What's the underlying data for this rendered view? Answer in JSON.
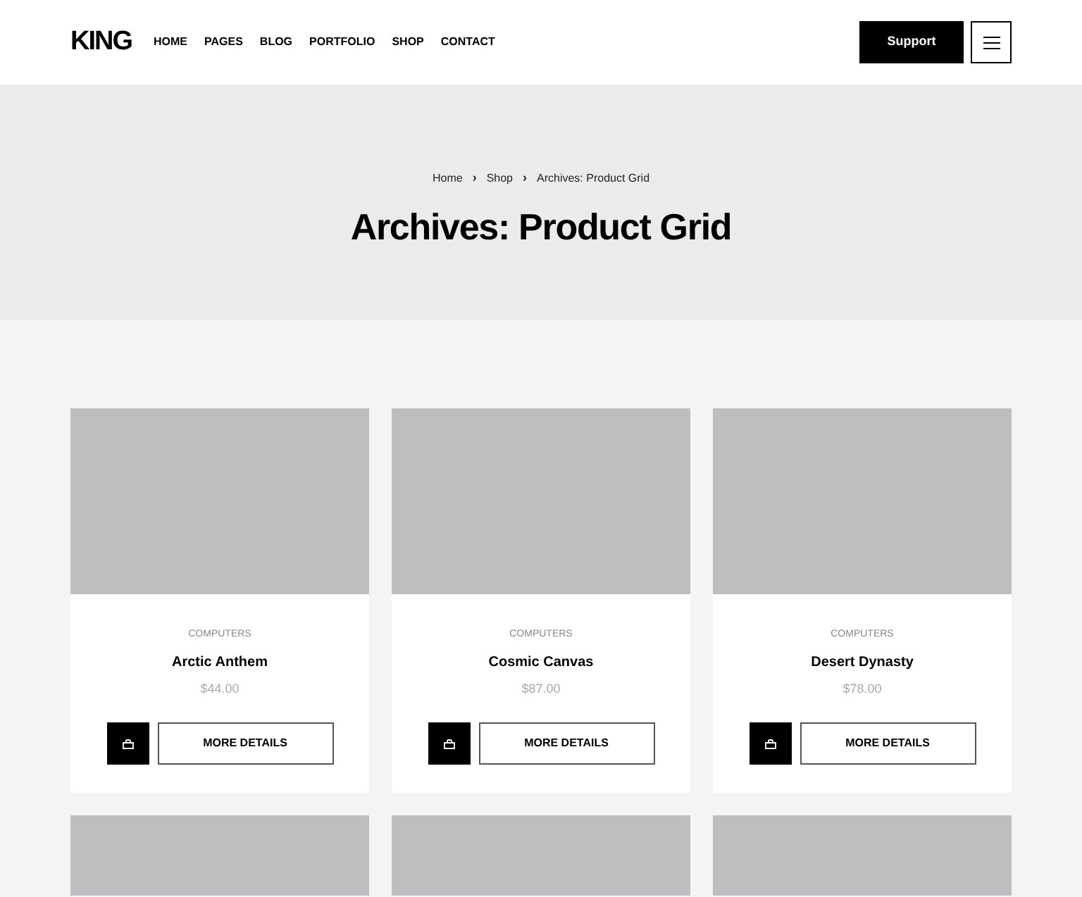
{
  "header": {
    "logo": "KING",
    "nav": [
      {
        "label": "HOME"
      },
      {
        "label": "PAGES"
      },
      {
        "label": "BLOG"
      },
      {
        "label": "PORTFOLIO"
      },
      {
        "label": "SHOP"
      },
      {
        "label": "CONTACT"
      }
    ],
    "button": "Support"
  },
  "hero": {
    "breadcrumb": [
      "Home",
      "Shop",
      "Archives: Product Grid"
    ],
    "separator": "›",
    "title": "Archives: Product Grid"
  },
  "products": [
    {
      "kind": "full",
      "category": "COMPUTERS",
      "name": "Arctic Anthem",
      "price": "$44.00",
      "button": "MORE DETAILS"
    },
    {
      "kind": "full",
      "category": "COMPUTERS",
      "name": "Cosmic Canvas",
      "price": "$87.00",
      "button": "MORE DETAILS"
    },
    {
      "kind": "full",
      "category": "COMPUTERS",
      "name": "Desert Dynasty",
      "price": "$78.00",
      "button": "MORE DETAILS"
    },
    {
      "kind": "cut_off"
    },
    {
      "kind": "cut_off"
    },
    {
      "kind": "cut_off"
    }
  ]
}
